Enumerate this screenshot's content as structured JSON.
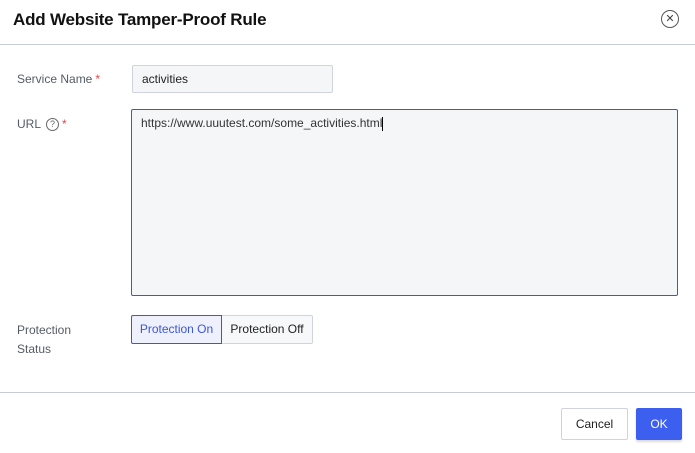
{
  "dialog": {
    "title": "Add Website Tamper-Proof Rule",
    "close_icon": "close-circle-icon"
  },
  "form": {
    "service_name": {
      "label": "Service Name",
      "required": "*",
      "value": "activities"
    },
    "url": {
      "label": "URL",
      "help": "?",
      "required": "*",
      "value": "https://www.uuutest.com/some_activities.html"
    },
    "protection_status": {
      "label_line1": "Protection",
      "label_line2": "Status",
      "options": [
        "Protection On",
        "Protection Off"
      ],
      "selected": "Protection On"
    }
  },
  "footer": {
    "cancel": "Cancel",
    "ok": "OK"
  },
  "colors": {
    "accent": "#3d5ff0",
    "required": "#e54545"
  }
}
